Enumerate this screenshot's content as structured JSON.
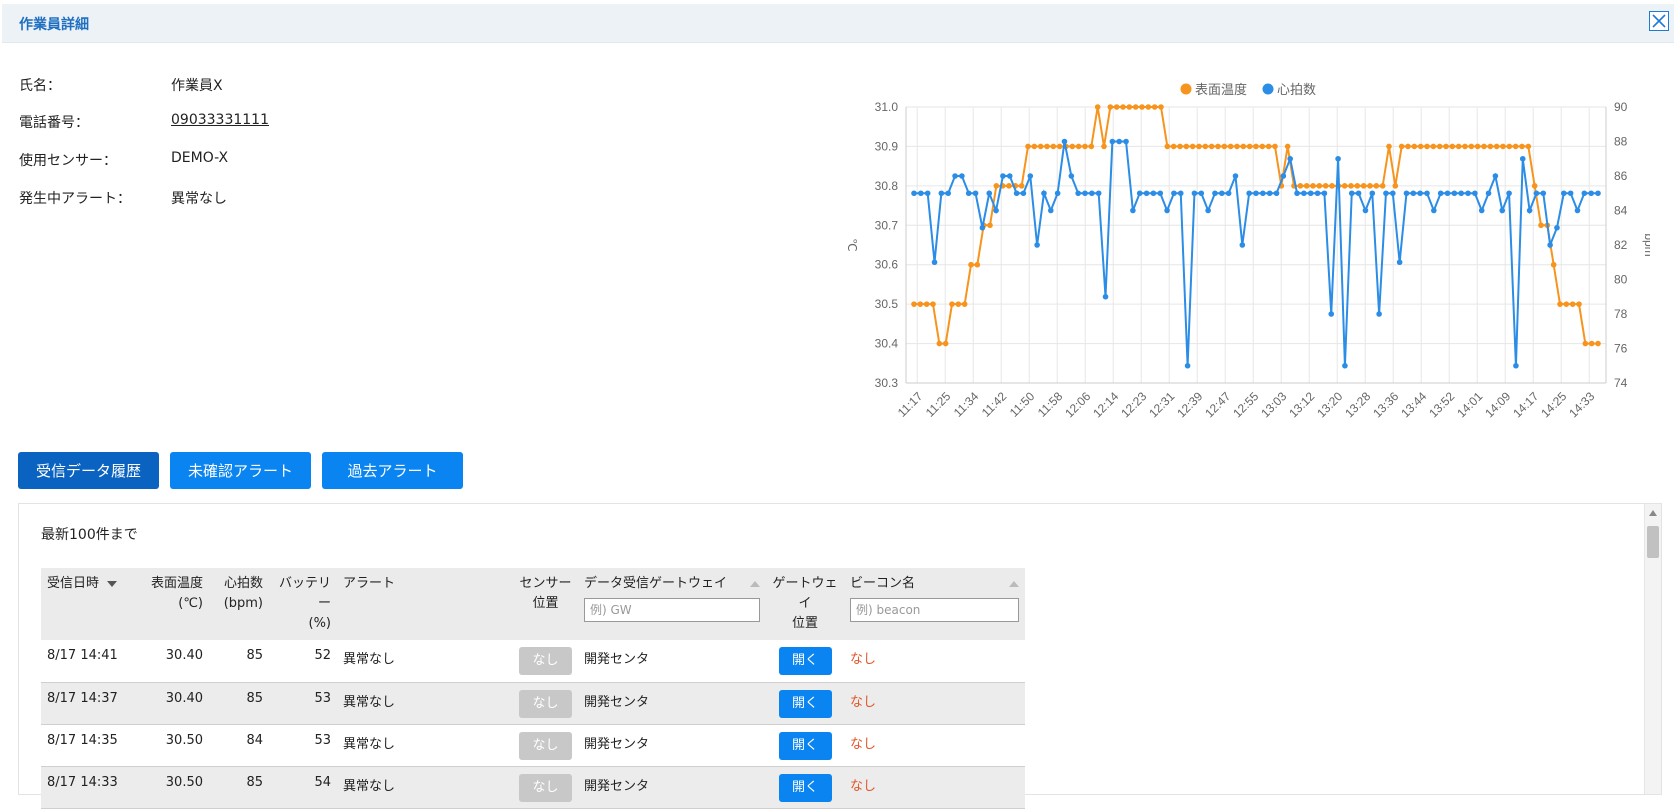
{
  "window": {
    "title": "作業員詳細"
  },
  "info": {
    "name_label": "氏名：",
    "name_value": "作業員X",
    "phone_label": "電話番号：",
    "phone_value": "09033331111",
    "sensor_label": "使用センサー：",
    "sensor_value": "DEMO-X",
    "alert_label": "発生中アラート：",
    "alert_value": "異常なし"
  },
  "tabs": {
    "history": "受信データ履歴",
    "unconfirmed": "未確認アラート",
    "past": "過去アラート"
  },
  "panel": {
    "note": "最新100件まで"
  },
  "table": {
    "headers": {
      "received": "受信日時",
      "temp_line1": "表面温度",
      "temp_line2": "(℃)",
      "hr_line1": "心拍数",
      "hr_line2": "(bpm)",
      "battery_line1": "バッテリー",
      "battery_line2": "(%)",
      "alert": "アラート",
      "sensor_line1": "センサー",
      "sensor_line2": "位置",
      "gateway": "データ受信ゲートウェイ",
      "gw_pos_line1": "ゲートウェイ",
      "gw_pos_line2": "位置",
      "beacon": "ビーコン名"
    },
    "filters": {
      "gateway_placeholder": "例) GW",
      "beacon_placeholder": "例) beacon"
    },
    "rows": [
      {
        "received": "8/17 14:41",
        "temp": "30.40",
        "hr": "85",
        "battery": "52",
        "alert": "異常なし",
        "sensor": "なし",
        "gateway": "開発センタ",
        "gw_pos": "開く",
        "beacon": "なし"
      },
      {
        "received": "8/17 14:37",
        "temp": "30.40",
        "hr": "85",
        "battery": "53",
        "alert": "異常なし",
        "sensor": "なし",
        "gateway": "開発センタ",
        "gw_pos": "開く",
        "beacon": "なし"
      },
      {
        "received": "8/17 14:35",
        "temp": "30.50",
        "hr": "84",
        "battery": "53",
        "alert": "異常なし",
        "sensor": "なし",
        "gateway": "開発センタ",
        "gw_pos": "開く",
        "beacon": "なし"
      },
      {
        "received": "8/17 14:33",
        "temp": "30.50",
        "hr": "85",
        "battery": "54",
        "alert": "異常なし",
        "sensor": "なし",
        "gateway": "開発センタ",
        "gw_pos": "開く",
        "beacon": "なし"
      }
    ]
  },
  "colors": {
    "temp_series": "#f7941d",
    "hr_series": "#2b8de6",
    "primary_button": "#0a84f0",
    "active_button": "#0a63c0",
    "title_text": "#1f6fc1"
  },
  "chart_data": {
    "type": "line",
    "legend_position": "top-center",
    "grid": true,
    "ylabel": "℃",
    "y2label": "bpm",
    "ylim": [
      30.3,
      31.0
    ],
    "y2lim": [
      74,
      90
    ],
    "yticks": [
      "31.0",
      "30.9",
      "30.8",
      "30.7",
      "30.6",
      "30.5",
      "30.4",
      "30.3"
    ],
    "y2ticks": [
      "90",
      "88",
      "86",
      "84",
      "82",
      "80",
      "78",
      "76",
      "74"
    ],
    "xticks": [
      "11:17",
      "11:25",
      "11:34",
      "11:42",
      "11:50",
      "11:58",
      "12:06",
      "12:14",
      "12:23",
      "12:31",
      "12:39",
      "12:47",
      "12:55",
      "13:03",
      "13:12",
      "13:20",
      "13:28",
      "13:36",
      "13:44",
      "13:52",
      "14:01",
      "14:09",
      "14:17",
      "14:25",
      "14:33"
    ],
    "series": [
      {
        "name": "表面温度",
        "axis": "left",
        "values": [
          30.5,
          30.5,
          30.5,
          30.5,
          30.4,
          30.4,
          30.5,
          30.5,
          30.5,
          30.6,
          30.6,
          30.7,
          30.7,
          30.8,
          30.8,
          30.8,
          30.8,
          30.8,
          30.9,
          30.9,
          30.9,
          30.9,
          30.9,
          30.9,
          30.9,
          30.9,
          30.9,
          30.9,
          30.9,
          31.0,
          30.9,
          31.0,
          31.0,
          31.0,
          31.0,
          31.0,
          31.0,
          31.0,
          31.0,
          31.0,
          30.9,
          30.9,
          30.9,
          30.9,
          30.9,
          30.9,
          30.9,
          30.9,
          30.9,
          30.9,
          30.9,
          30.9,
          30.9,
          30.9,
          30.9,
          30.9,
          30.9,
          30.9,
          30.8,
          30.9,
          30.8,
          30.8,
          30.8,
          30.8,
          30.8,
          30.8,
          30.8,
          30.8,
          30.8,
          30.8,
          30.8,
          30.8,
          30.8,
          30.8,
          30.8,
          30.9,
          30.8,
          30.9,
          30.9,
          30.9,
          30.9,
          30.9,
          30.9,
          30.9,
          30.9,
          30.9,
          30.9,
          30.9,
          30.9,
          30.9,
          30.9,
          30.9,
          30.9,
          30.9,
          30.9,
          30.9,
          30.9,
          30.9,
          30.8,
          30.7,
          30.7,
          30.6,
          30.5,
          30.5,
          30.5,
          30.5,
          30.4,
          30.4,
          30.4
        ]
      },
      {
        "name": "心拍数",
        "axis": "right",
        "values": [
          85,
          85,
          85,
          81,
          85,
          85,
          86,
          86,
          85,
          85,
          83,
          85,
          84,
          86,
          86,
          85,
          85,
          86,
          82,
          85,
          84,
          85,
          88,
          86,
          85,
          85,
          85,
          85,
          79,
          88,
          88,
          88,
          84,
          85,
          85,
          85,
          85,
          84,
          85,
          85,
          75,
          85,
          85,
          84,
          85,
          85,
          85,
          86,
          82,
          85,
          85,
          85,
          85,
          85,
          86,
          87,
          85,
          85,
          85,
          85,
          85,
          78,
          87,
          75,
          85,
          85,
          84,
          85,
          78,
          85,
          85,
          81,
          85,
          85,
          85,
          85,
          84,
          85,
          85,
          85,
          85,
          85,
          85,
          84,
          85,
          86,
          84,
          85,
          75,
          87,
          84,
          85,
          85,
          82,
          83,
          85,
          85,
          84,
          85,
          85,
          85
        ]
      }
    ]
  }
}
